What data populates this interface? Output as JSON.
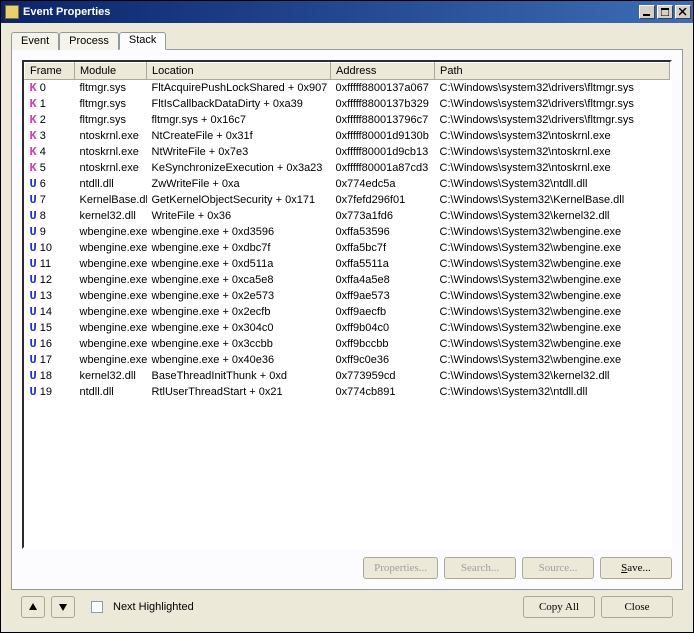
{
  "window": {
    "title": "Event Properties",
    "minimize": "_",
    "maximize": "□",
    "close": "×"
  },
  "tabs": {
    "event": "Event",
    "process": "Process",
    "stack": "Stack"
  },
  "columns": {
    "frame": "Frame",
    "module": "Module",
    "location": "Location",
    "address": "Address",
    "path": "Path"
  },
  "rows": [
    {
      "mode": "K",
      "frame": "0",
      "module": "fltmgr.sys",
      "location": "FltAcquirePushLockShared + 0x907",
      "address": "0xfffff8800137a067",
      "path": "C:\\Windows\\system32\\drivers\\fltmgr.sys"
    },
    {
      "mode": "K",
      "frame": "1",
      "module": "fltmgr.sys",
      "location": "FltIsCallbackDataDirty + 0xa39",
      "address": "0xfffff8800137b329",
      "path": "C:\\Windows\\system32\\drivers\\fltmgr.sys"
    },
    {
      "mode": "K",
      "frame": "2",
      "module": "fltmgr.sys",
      "location": "fltmgr.sys + 0x16c7",
      "address": "0xfffff880013796c7",
      "path": "C:\\Windows\\system32\\drivers\\fltmgr.sys"
    },
    {
      "mode": "K",
      "frame": "3",
      "module": "ntoskrnl.exe",
      "location": "NtCreateFile + 0x31f",
      "address": "0xfffff80001d9130b",
      "path": "C:\\Windows\\system32\\ntoskrnl.exe"
    },
    {
      "mode": "K",
      "frame": "4",
      "module": "ntoskrnl.exe",
      "location": "NtWriteFile + 0x7e3",
      "address": "0xfffff80001d9cb13",
      "path": "C:\\Windows\\system32\\ntoskrnl.exe"
    },
    {
      "mode": "K",
      "frame": "5",
      "module": "ntoskrnl.exe",
      "location": "KeSynchronizeExecution + 0x3a23",
      "address": "0xfffff80001a87cd3",
      "path": "C:\\Windows\\system32\\ntoskrnl.exe"
    },
    {
      "mode": "U",
      "frame": "6",
      "module": "ntdll.dll",
      "location": "ZwWriteFile + 0xa",
      "address": "0x774edc5a",
      "path": "C:\\Windows\\System32\\ntdll.dll"
    },
    {
      "mode": "U",
      "frame": "7",
      "module": "KernelBase.dll",
      "location": "GetKernelObjectSecurity + 0x171",
      "address": "0x7fefd296f01",
      "path": "C:\\Windows\\System32\\KernelBase.dll"
    },
    {
      "mode": "U",
      "frame": "8",
      "module": "kernel32.dll",
      "location": "WriteFile + 0x36",
      "address": "0x773a1fd6",
      "path": "C:\\Windows\\System32\\kernel32.dll"
    },
    {
      "mode": "U",
      "frame": "9",
      "module": "wbengine.exe",
      "location": "wbengine.exe + 0xd3596",
      "address": "0xffa53596",
      "path": "C:\\Windows\\System32\\wbengine.exe"
    },
    {
      "mode": "U",
      "frame": "10",
      "module": "wbengine.exe",
      "location": "wbengine.exe + 0xdbc7f",
      "address": "0xffa5bc7f",
      "path": "C:\\Windows\\System32\\wbengine.exe"
    },
    {
      "mode": "U",
      "frame": "11",
      "module": "wbengine.exe",
      "location": "wbengine.exe + 0xd511a",
      "address": "0xffa5511a",
      "path": "C:\\Windows\\System32\\wbengine.exe"
    },
    {
      "mode": "U",
      "frame": "12",
      "module": "wbengine.exe",
      "location": "wbengine.exe + 0xca5e8",
      "address": "0xffa4a5e8",
      "path": "C:\\Windows\\System32\\wbengine.exe"
    },
    {
      "mode": "U",
      "frame": "13",
      "module": "wbengine.exe",
      "location": "wbengine.exe + 0x2e573",
      "address": "0xff9ae573",
      "path": "C:\\Windows\\System32\\wbengine.exe"
    },
    {
      "mode": "U",
      "frame": "14",
      "module": "wbengine.exe",
      "location": "wbengine.exe + 0x2ecfb",
      "address": "0xff9aecfb",
      "path": "C:\\Windows\\System32\\wbengine.exe"
    },
    {
      "mode": "U",
      "frame": "15",
      "module": "wbengine.exe",
      "location": "wbengine.exe + 0x304c0",
      "address": "0xff9b04c0",
      "path": "C:\\Windows\\System32\\wbengine.exe"
    },
    {
      "mode": "U",
      "frame": "16",
      "module": "wbengine.exe",
      "location": "wbengine.exe + 0x3ccbb",
      "address": "0xff9bccbb",
      "path": "C:\\Windows\\System32\\wbengine.exe"
    },
    {
      "mode": "U",
      "frame": "17",
      "module": "wbengine.exe",
      "location": "wbengine.exe + 0x40e36",
      "address": "0xff9c0e36",
      "path": "C:\\Windows\\System32\\wbengine.exe"
    },
    {
      "mode": "U",
      "frame": "18",
      "module": "kernel32.dll",
      "location": "BaseThreadInitThunk + 0xd",
      "address": "0x773959cd",
      "path": "C:\\Windows\\System32\\kernel32.dll"
    },
    {
      "mode": "U",
      "frame": "19",
      "module": "ntdll.dll",
      "location": "RtlUserThreadStart + 0x21",
      "address": "0x774cb891",
      "path": "C:\\Windows\\System32\\ntdll.dll"
    }
  ],
  "buttons": {
    "properties": "Properties...",
    "search": "Search...",
    "source": "Source...",
    "save": "Save..."
  },
  "bottom": {
    "next_highlighted": "Next Highlighted",
    "copy_all": "Copy All",
    "close": "Close"
  }
}
